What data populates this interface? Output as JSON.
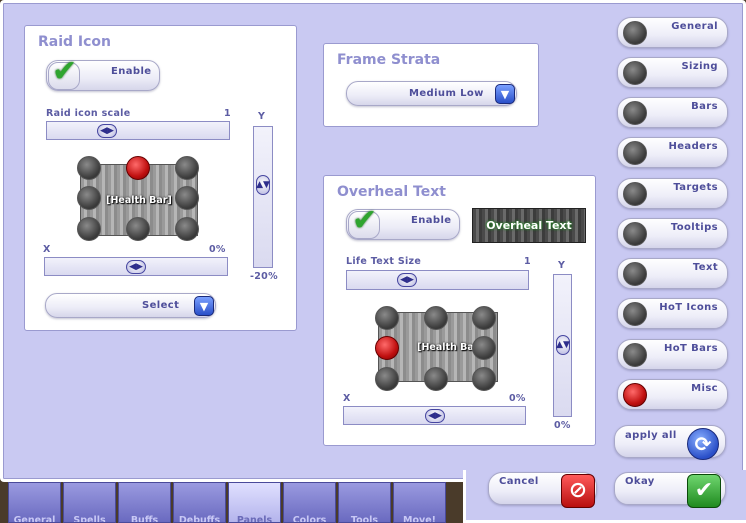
{
  "raid_icon": {
    "title": "Raid Icon",
    "enable_label": "Enable",
    "scale_label": "Raid icon scale",
    "scale_value": "1",
    "y_label": "Y",
    "y_value": "-20%",
    "x_label": "X",
    "x_value": "0%",
    "health_bar_label": "[Health Bar]",
    "select_label": "Select"
  },
  "frame_strata": {
    "title": "Frame Strata",
    "selected": "Medium Low"
  },
  "overheal_text": {
    "title": "Overheal Text",
    "enable_label": "Enable",
    "preview_label": "Overheal Text",
    "size_label": "Life Text Size",
    "size_value": "1",
    "y_label": "Y",
    "y_value": "0%",
    "x_label": "X",
    "x_value": "0%",
    "health_bar_label": "[Health Bar]"
  },
  "sidebar": {
    "items": [
      {
        "label": "General"
      },
      {
        "label": "Sizing"
      },
      {
        "label": "Bars"
      },
      {
        "label": "Headers"
      },
      {
        "label": "Targets"
      },
      {
        "label": "Tooltips"
      },
      {
        "label": "Text"
      },
      {
        "label": "HoT Icons"
      },
      {
        "label": "HoT Bars"
      },
      {
        "label": "Misc"
      }
    ],
    "apply_all_label": "apply all"
  },
  "footer": {
    "cancel_label": "Cancel",
    "okay_label": "Okay"
  },
  "tabs": [
    {
      "label": "General"
    },
    {
      "label": "Spells"
    },
    {
      "label": "Buffs"
    },
    {
      "label": "Debuffs"
    },
    {
      "label": "Panels"
    },
    {
      "label": "Colors"
    },
    {
      "label": "Tools"
    },
    {
      "label": "Move!"
    }
  ],
  "colors": {
    "background": "#c9c9f2",
    "panel_title": "#8f8fcf",
    "label": "#5c5ca3",
    "accent_blue": "#2a4fc8",
    "check_green": "#2fa52f",
    "cancel_red": "#d01818"
  }
}
